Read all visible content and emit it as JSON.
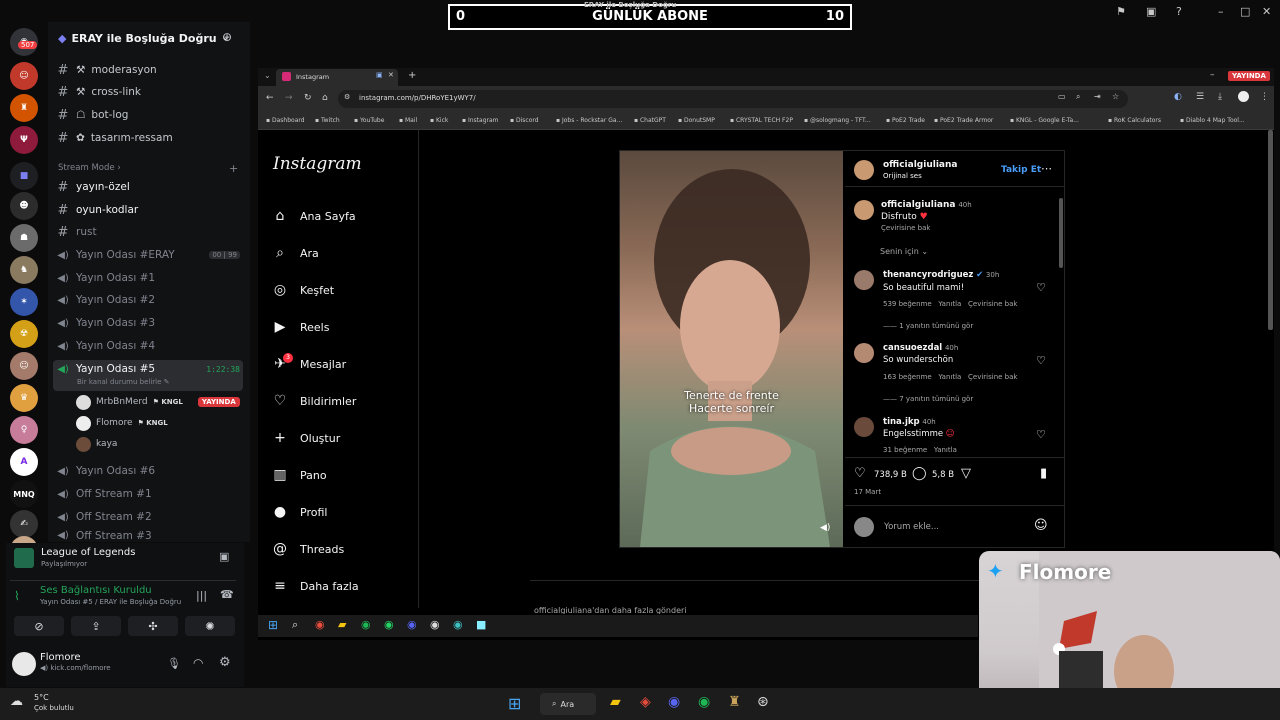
{
  "counter": {
    "left": "0",
    "title": "GÜNLÜK ABONE",
    "right": "10",
    "overlay_text": "ERAY ile Boşluğa Doğru"
  },
  "discord": {
    "server_name": "ERAY ile Boşluğa Doğru",
    "badge_count": "507",
    "top_channels": [
      {
        "name": "moderasyon"
      },
      {
        "name": "cross-link"
      },
      {
        "name": "bot-log"
      },
      {
        "name": "tasarım-ressam"
      }
    ],
    "section": "Stream Mode",
    "channels": [
      {
        "name": "yayın-özel",
        "type": "text",
        "bright": true
      },
      {
        "name": "oyun-kodlar",
        "type": "text",
        "bright": true
      },
      {
        "name": "rust",
        "type": "text",
        "bright": false
      },
      {
        "name": "Yayın Odası #ERAY",
        "type": "voice"
      },
      {
        "name": "Yayın Odası #1",
        "type": "voice"
      },
      {
        "name": "Yayın Odası #2",
        "type": "voice"
      },
      {
        "name": "Yayın Odası #3",
        "type": "voice"
      },
      {
        "name": "Yayın Odası #4",
        "type": "voice"
      }
    ],
    "eray_counts": [
      "00",
      "99"
    ],
    "active_channel": {
      "name": "Yayın Odası #5",
      "time": "1:22:38",
      "status": "Bir kanal durumu belirle"
    },
    "voice_users": [
      {
        "name": "MrbBnMerd",
        "tag": "KNGL",
        "live": "YAYINDA"
      },
      {
        "name": "Flomore",
        "tag": "KNGL"
      },
      {
        "name": "kaya"
      }
    ],
    "more_channels": [
      "Yayın Odası #6",
      "Off Stream #1",
      "Off Stream #2",
      "Off Stream #3"
    ],
    "activity": {
      "game": "League of Legends",
      "status": "Paylaşılmıyor"
    },
    "voice": {
      "status": "Ses Bağlantısı Kuruldu",
      "detail": "Yayın Odası #5 / ERAY ile Boşluğa Doğru"
    },
    "user": {
      "name": "Flomore",
      "sub": "kick.com/flomore"
    }
  },
  "weather": {
    "temp": "5°C",
    "desc": "Çok bulutlu"
  },
  "browser": {
    "tab_title": "Instagram",
    "url": "instagram.com/p/DHRoYE1yWY7/",
    "live_badge": "YAYINDA",
    "bookmarks": [
      "Dashboard",
      "Twitch",
      "YouTube",
      "Mail",
      "Kick",
      "Instagram",
      "Discord",
      "Jobs - Rockstar Ga...",
      "ChatGPT",
      "DonutSMP",
      "CRYSTAL TECH F2P",
      "@sologmang - TFT...",
      "PoE2 Trade",
      "PoE2 Trade Armor",
      "KNGL - Google E-Ta...",
      "RoK Calculators",
      "Diablo 4 Map Tool..."
    ]
  },
  "instagram": {
    "logo": "Instagram",
    "nav": [
      "Ana Sayfa",
      "Ara",
      "Keşfet",
      "Reels",
      "Mesajlar",
      "Bildirimler",
      "Oluştur",
      "Pano",
      "Profil",
      "Threads",
      "Daha fazla"
    ],
    "messages_badge": "3",
    "post": {
      "author": "officialgiuliana",
      "audio": "Orijinal ses",
      "follow": "Takip Et",
      "caption_user": "officialgiuliana",
      "caption_time": "40h",
      "caption": "Disfruto",
      "translate": "Çevirisine bak",
      "for_you": "Senin için",
      "subtitle_line1": "Tenerte de frente",
      "subtitle_line2": "Hacerte sonreír",
      "likes": "738,9 B",
      "comments_count": "5,8 B",
      "date": "17 Mart",
      "comment_placeholder": "Yorum ekle...",
      "more_posts": "officialgiuliana'dan daha fazla gönderi"
    },
    "comments": [
      {
        "user": "thenancyrodriguez",
        "time": "30h",
        "text": "So beautiful mami!",
        "likes": "539 beğenme",
        "reply": "Yanıtla",
        "translate": "Çevirisine bak",
        "replies": "1 yanıtın tümünü gör"
      },
      {
        "user": "cansuoezdal",
        "time": "40h",
        "text": "So wunderschön",
        "likes": "163 beğenme",
        "reply": "Yanıtla",
        "translate": "Çevirisine bak",
        "replies": "7 yanıtın tümünü gör"
      },
      {
        "user": "tina.jkp",
        "time": "40h",
        "text": "Engelsstimme",
        "likes": "31 beğenme",
        "reply": "Yanıtla"
      }
    ]
  },
  "webcam": {
    "name": "Flomore"
  },
  "taskbar": {
    "search": "Ara"
  }
}
